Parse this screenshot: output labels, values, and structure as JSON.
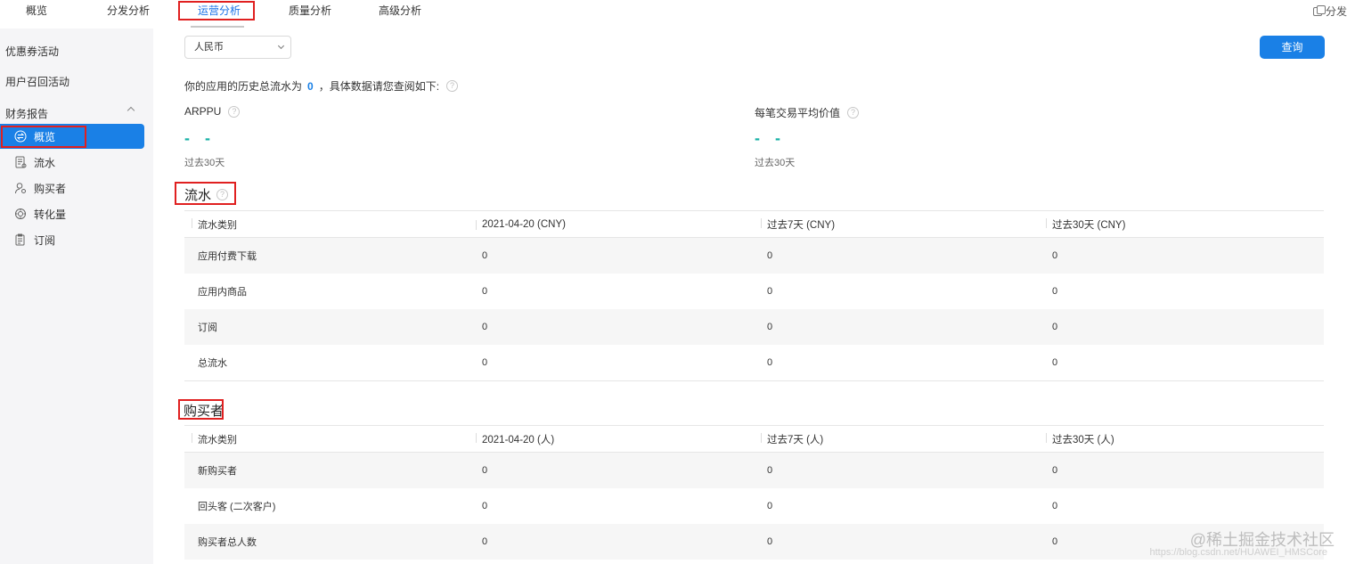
{
  "top_tabs": [
    {
      "label": "概览"
    },
    {
      "label": "分发分析"
    },
    {
      "label": "运营分析"
    },
    {
      "label": "质量分析"
    },
    {
      "label": "高级分析"
    }
  ],
  "top_right": {
    "label": "分发"
  },
  "sidebar": {
    "links": [
      {
        "label": "优惠券活动"
      },
      {
        "label": "用户召回活动"
      }
    ],
    "group_label": "财务报告",
    "items": [
      {
        "label": "概览",
        "icon": "exchange-icon"
      },
      {
        "label": "流水",
        "icon": "document-icon"
      },
      {
        "label": "购买者",
        "icon": "user-icon"
      },
      {
        "label": "转化量",
        "icon": "cycle-icon"
      },
      {
        "label": "订阅",
        "icon": "clipboard-icon"
      }
    ]
  },
  "filter": {
    "currency": "人民币",
    "query_label": "查询"
  },
  "summary": {
    "prefix": "你的应用的历史总流水为",
    "value": "0",
    "suffix": "，具体数据请您查阅如下:"
  },
  "metrics": [
    {
      "label": "ARPPU",
      "value": "- -",
      "period": "过去30天"
    },
    {
      "label": "每笔交易平均价值",
      "value": "- -",
      "period": "过去30天"
    }
  ],
  "revenue": {
    "title": "流水",
    "headers": [
      "流水类别",
      "2021-04-20 (CNY)",
      "过去7天 (CNY)",
      "过去30天 (CNY)"
    ],
    "rows": [
      [
        "应用付费下载",
        "0",
        "0",
        "0"
      ],
      [
        "应用内商品",
        "0",
        "0",
        "0"
      ],
      [
        "订阅",
        "0",
        "0",
        "0"
      ],
      [
        "总流水",
        "0",
        "0",
        "0"
      ]
    ]
  },
  "buyers": {
    "title": "购买者",
    "headers": [
      "流水类别",
      "2021-04-20 (人)",
      "过去7天 (人)",
      "过去30天 (人)"
    ],
    "rows": [
      [
        "新购买者",
        "0",
        "0",
        "0"
      ],
      [
        "回头客 (二次客户)",
        "0",
        "0",
        "0"
      ],
      [
        "购买者总人数",
        "0",
        "0",
        "0"
      ]
    ]
  },
  "watermark": {
    "line1": "@稀土掘金技术社区",
    "line2": "https://blog.csdn.net/HUAWEI_HMSCore"
  },
  "colors": {
    "accent": "#1a80e6",
    "metric_value": "#16b0a6",
    "highlight_box": "#e02020"
  }
}
